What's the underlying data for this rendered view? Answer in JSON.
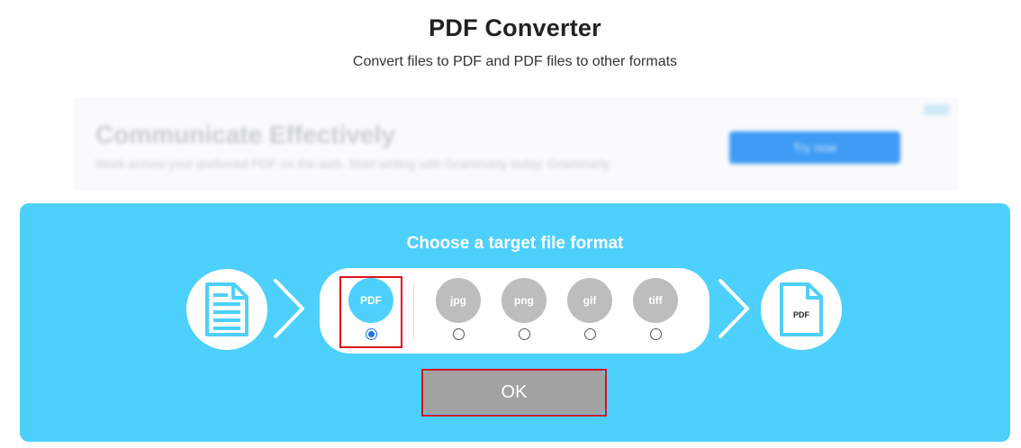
{
  "page": {
    "title": "PDF Converter",
    "subtitle": "Convert files to PDF and PDF files to other formats"
  },
  "ad": {
    "headline": "Communicate Effectively",
    "text": "Work across your preferred PDF on the web. Start writing with Grammarly today. Grammarly",
    "button_label": "Try now"
  },
  "converter": {
    "heading": "Choose a target file format",
    "source_icon": "document-icon",
    "target_icon": "pdf-file-icon",
    "target_label": "PDF",
    "selected_format": "PDF",
    "formats": [
      {
        "label": "PDF",
        "selected": true
      },
      {
        "label": "jpg",
        "selected": false
      },
      {
        "label": "png",
        "selected": false
      },
      {
        "label": "gif",
        "selected": false
      },
      {
        "label": "tiff",
        "selected": false
      }
    ],
    "ok_label": "OK"
  },
  "colors": {
    "panel": "#4dd0fc",
    "inactive_format": "#bdbdbd",
    "ok_button": "#a2a2a2",
    "highlight": "#e0101a"
  }
}
